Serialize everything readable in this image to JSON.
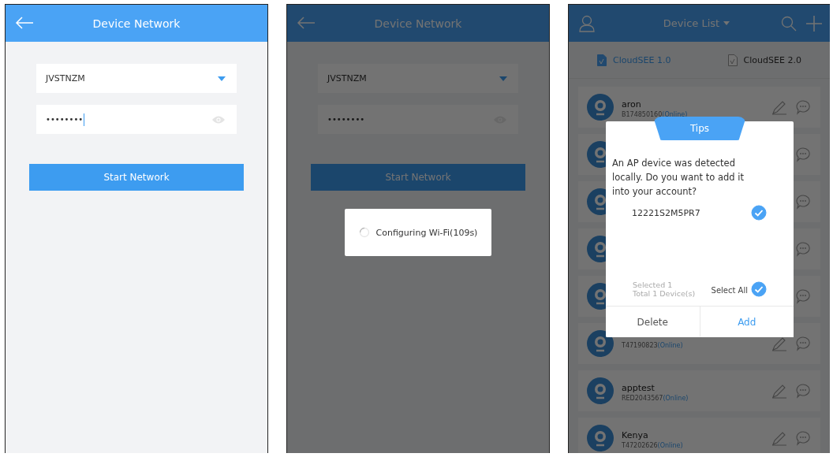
{
  "screens": [
    {
      "kind": "form",
      "header": {
        "title": "Device Network"
      },
      "wifi_field": {
        "value": "JVSTNZM"
      },
      "password_field": {
        "value": "••••••••",
        "focused": true
      },
      "start_button": {
        "label": "Start Network"
      }
    },
    {
      "kind": "form",
      "header": {
        "title": "Device Network"
      },
      "wifi_field": {
        "value": "JVSTNZM"
      },
      "password_field": {
        "value": "••••••••",
        "focused": false
      },
      "start_button": {
        "label": "Start Network"
      },
      "progress_dialog": {
        "message": "Configuring Wi-Fi(109s)"
      }
    },
    {
      "kind": "list",
      "header": {
        "title": "Device List"
      },
      "tabs": [
        {
          "label": "CloudSEE 1.0",
          "selected": true
        },
        {
          "label": "CloudSEE 2.0",
          "selected": false
        }
      ],
      "devices_above_dialog": [
        {
          "name": "aron",
          "id": "B174850160",
          "status": "(Online)"
        }
      ],
      "devices_below_dialog": [
        {
          "id": "T47190823",
          "status": "(Online)"
        },
        {
          "name": "apptest",
          "id": "RED2043567",
          "status": "(Online)"
        },
        {
          "name": "Kenya",
          "id": "T47202626",
          "status": "(Online)"
        }
      ],
      "dialog": {
        "title": "Tips",
        "message": "An AP device was detected locally. Do you want to add it into your account?",
        "devices": [
          {
            "id": "12221S2M5PR7",
            "selected": true
          }
        ],
        "selected_count": "Selected 1",
        "total_count": "Total 1 Device(s)",
        "select_all": {
          "label": "Select All",
          "checked": true
        },
        "buttons": [
          {
            "label": "Delete",
            "kind": "cancel"
          },
          {
            "label": "Add",
            "kind": "confirm"
          }
        ]
      }
    }
  ]
}
